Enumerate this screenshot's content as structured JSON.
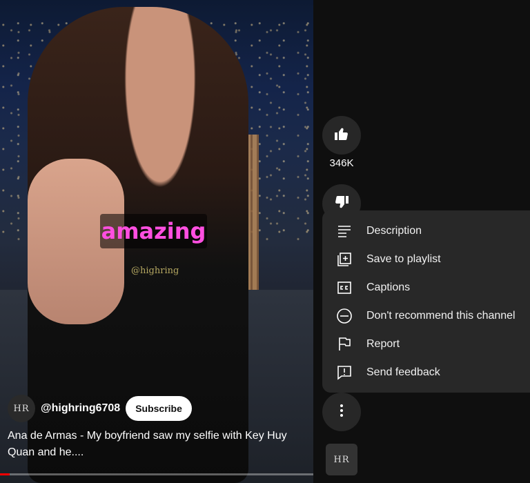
{
  "video": {
    "overlay_caption": "amazing",
    "watermark": "@highring",
    "channel": {
      "avatar_text": "HR",
      "handle": "@highring6708",
      "subscribe_label": "Subscribe"
    },
    "title": "Ana de Armas - My boyfriend saw my selfie with Key Huy Quan and he....",
    "progress_fraction": 0.03
  },
  "actions": {
    "like_icon": "thumbs-up-icon",
    "like_count": "346K",
    "dislike_icon": "thumbs-down-icon",
    "more_icon": "more-vertical-icon"
  },
  "menu": {
    "items": [
      {
        "icon": "description-icon",
        "label": "Description"
      },
      {
        "icon": "playlist-add-icon",
        "label": "Save to playlist"
      },
      {
        "icon": "captions-icon",
        "label": "Captions"
      },
      {
        "icon": "block-icon",
        "label": "Don't recommend this channel"
      },
      {
        "icon": "flag-icon",
        "label": "Report"
      },
      {
        "icon": "feedback-icon",
        "label": "Send feedback"
      }
    ]
  },
  "channel_thumb_text": "HR",
  "colors": {
    "background": "#0f0f0f",
    "menu_bg": "#282828",
    "button_bg": "#272727",
    "caption_pink": "#ff4fe0",
    "progress_red": "#ff0000"
  }
}
